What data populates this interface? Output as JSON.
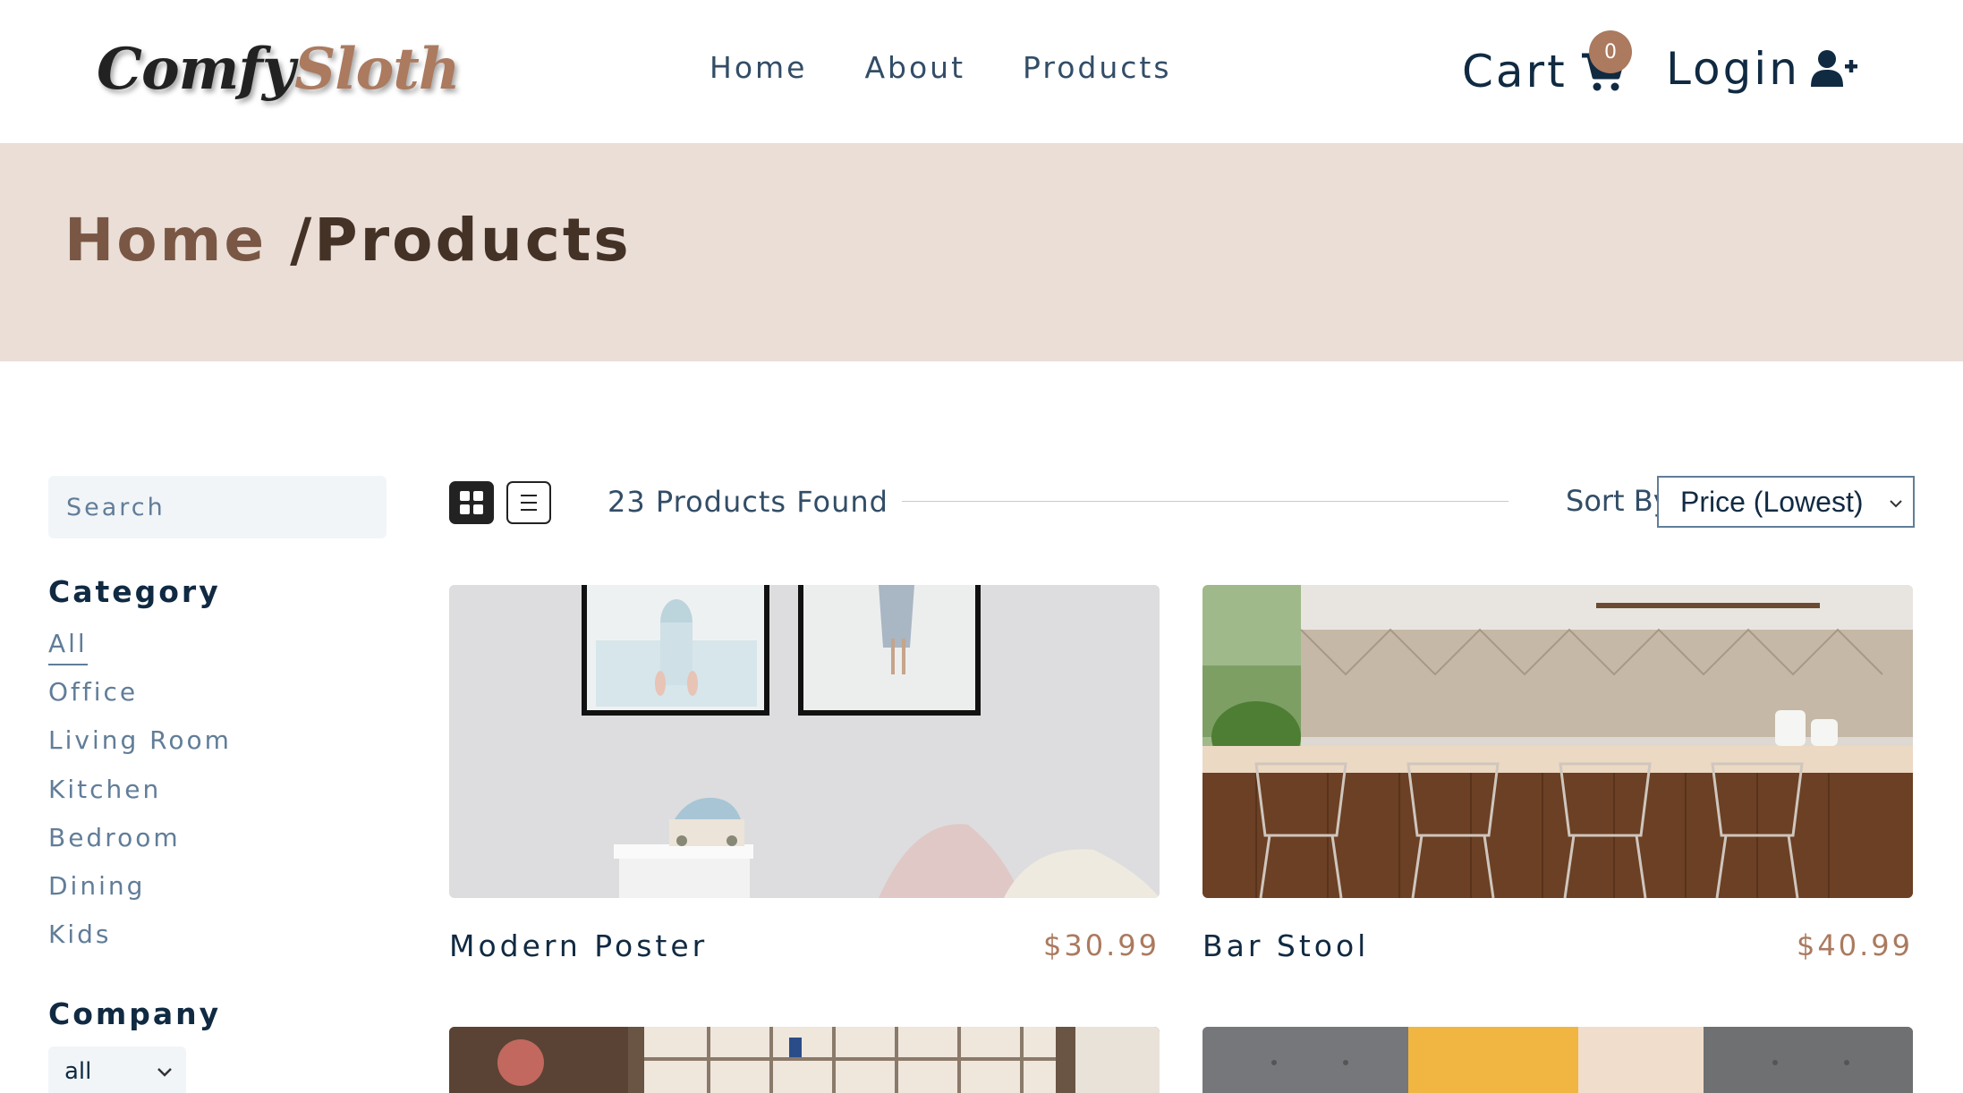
{
  "nav": {
    "logo_part1": "Comfy",
    "logo_part2": "Sloth",
    "links": [
      "Home",
      "About",
      "Products"
    ],
    "cart_label": "Cart",
    "cart_count": "0",
    "login_label": "Login",
    "cart_icon": "shopping-cart-icon",
    "login_icon": "user-plus-icon"
  },
  "hero": {
    "home": "Home",
    "current": " /Products"
  },
  "filters": {
    "search_placeholder": "Search",
    "category_heading": "Category",
    "categories": [
      "All",
      "Office",
      "Living Room",
      "Kitchen",
      "Bedroom",
      "Dining",
      "Kids"
    ],
    "active_category": "All",
    "company_heading": "Company",
    "company_selected": "all"
  },
  "toolbar": {
    "grid_icon": "grid-view-icon",
    "list_icon": "list-view-icon",
    "products_found": "23 Products Found",
    "sort_label": "Sort By",
    "sort_selected": "Price (Lowest)"
  },
  "products": [
    {
      "name": "Modern Poster",
      "price": "$30.99"
    },
    {
      "name": "Bar Stool",
      "price": "$40.99"
    }
  ],
  "colors": {
    "accent": "#ab7a5f",
    "hero_bg": "#eaded7",
    "hero_text": "#453227",
    "primary_text": "#102a42"
  }
}
